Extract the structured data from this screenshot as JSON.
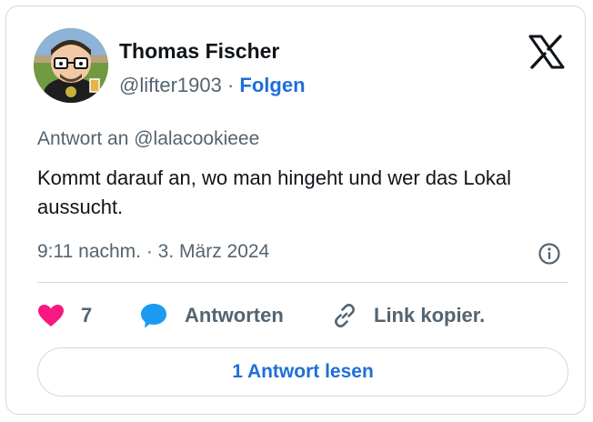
{
  "author": {
    "name": "Thomas Fischer",
    "handle": "@lifter1903",
    "separator": "·",
    "follow_label": "Folgen"
  },
  "tweet": {
    "reply_to": "Antwort an @lalacookieee",
    "text": "Kommt darauf an, wo man hingeht und wer das Lokal aussucht.",
    "timestamp": "9:11 nachm. · 3. März 2024"
  },
  "actions": {
    "like_count": "7",
    "reply_label": "Antworten",
    "copy_label": "Link kopier."
  },
  "read_replies_label": "1 Antwort lesen",
  "icons": {
    "brand": "x-logo-icon",
    "info": "info-icon",
    "like": "heart-icon",
    "reply": "speech-bubble-icon",
    "copy": "link-icon"
  },
  "colors": {
    "accent": "#1d6fd8",
    "like": "#f91880",
    "reply_icon": "#1d9bf0",
    "muted": "#536471"
  }
}
